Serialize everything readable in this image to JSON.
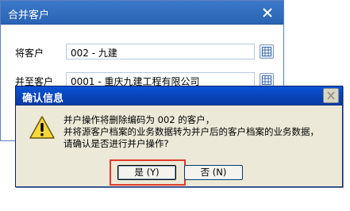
{
  "merge_dialog": {
    "title": "合并客户",
    "from_label": "将客户",
    "from_value": "002 - 九建",
    "to_label": "并至客户",
    "to_value": "0001 - 重庆九建工程有限公司"
  },
  "confirm_dialog": {
    "title": "确认信息",
    "message_lines": [
      "并户操作将删除编码为 002 的客户，",
      "并将源客户档案的业务数据转为并户后的客户档案的业务数据，",
      "请确认是否进行并户操作?"
    ],
    "yes_label": "是 (Y)",
    "no_label": "否 (N)"
  },
  "colors": {
    "highlight": "#e03a2c",
    "merge_titlebar": "#2f6cc0",
    "confirm_titlebar": "#0842b6"
  }
}
